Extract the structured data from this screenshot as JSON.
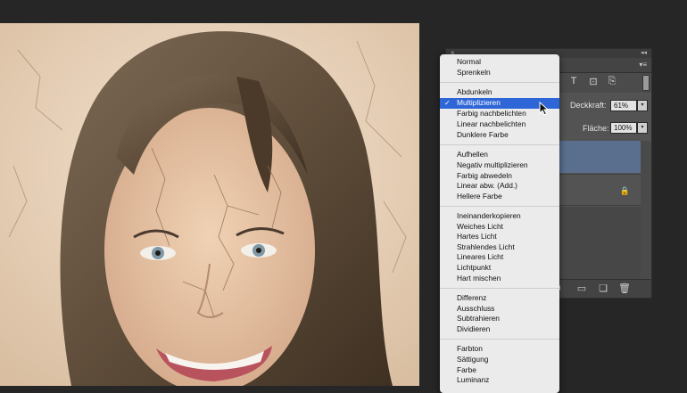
{
  "photo": {
    "description_icon": "portrait-photo"
  },
  "layers_panel": {
    "close_glyph": "×",
    "collapse_glyph": "◂◂",
    "menu_glyph": "▾≡",
    "filter_icons": [
      "type-icon",
      "shape-icon",
      "smart-object-icon"
    ],
    "filter_glyphs": [
      "T",
      "⊡",
      "⎘"
    ],
    "opacity_label": "Deckkraft:",
    "opacity_value": "61%",
    "fill_label": "Fläche:",
    "fill_value": "100%",
    "lock_glyph": "🔒",
    "bottom_glyphs": [
      "◐",
      "▭",
      "❏",
      "🗑"
    ]
  },
  "blend_menu": {
    "groups": [
      [
        "Normal",
        "Sprenkeln"
      ],
      [
        "Abdunkeln",
        "Multiplizieren",
        "Farbig nachbelichten",
        "Linear nachbelichten",
        "Dunklere Farbe"
      ],
      [
        "Aufhellen",
        "Negativ multiplizieren",
        "Farbig abwedeln",
        "Linear abw. (Add.)",
        "Hellere Farbe"
      ],
      [
        "Ineinanderkopieren",
        "Weiches Licht",
        "Hartes Licht",
        "Strahlendes Licht",
        "Lineares Licht",
        "Lichtpunkt",
        "Hart mischen"
      ],
      [
        "Differenz",
        "Ausschluss",
        "Subtrahieren",
        "Dividieren"
      ],
      [
        "Farbton",
        "Sättigung",
        "Farbe",
        "Luminanz"
      ]
    ],
    "selected": "Multiplizieren",
    "check_glyph": "✓",
    "selected_color": "#2e66d8"
  }
}
